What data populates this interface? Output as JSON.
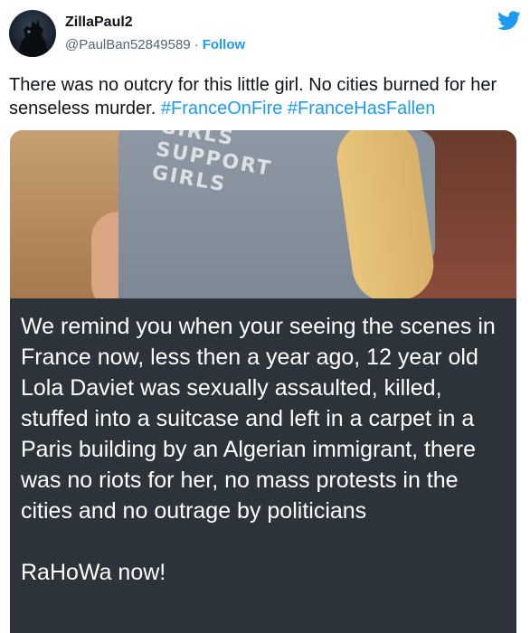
{
  "author": {
    "display_name": "ZillaPaul2",
    "handle": "@PaulBan52849589",
    "separator": "·",
    "follow_label": "Follow"
  },
  "tweet": {
    "text_main": "There was no outcry for this little girl. No cities burned for her senseless murder.",
    "hashtags": [
      "#FranceOnFire",
      "#FranceHasFallen"
    ]
  },
  "media": {
    "shirt_text": [
      "GIRLS",
      "SUPPORT",
      "GIRLS"
    ],
    "caption": "We remind you when your seeing the scenes in France now, less then a year ago, 12 year old Lola Daviet was sexually assaulted, killed, stuffed into a suitcase and left in a carpet in a Paris building by an Algerian immigrant, there was no riots for her, no mass protests in the cities and no outrage by politicians",
    "caption_end": "RaHoWa now!"
  },
  "colors": {
    "accent": "#1d9bf0",
    "text": "#0f1419",
    "muted": "#536471",
    "meme_bg": "#2c333b"
  },
  "icons": {
    "brand": "twitter-bird-icon",
    "avatar": "godzilla-avatar"
  }
}
